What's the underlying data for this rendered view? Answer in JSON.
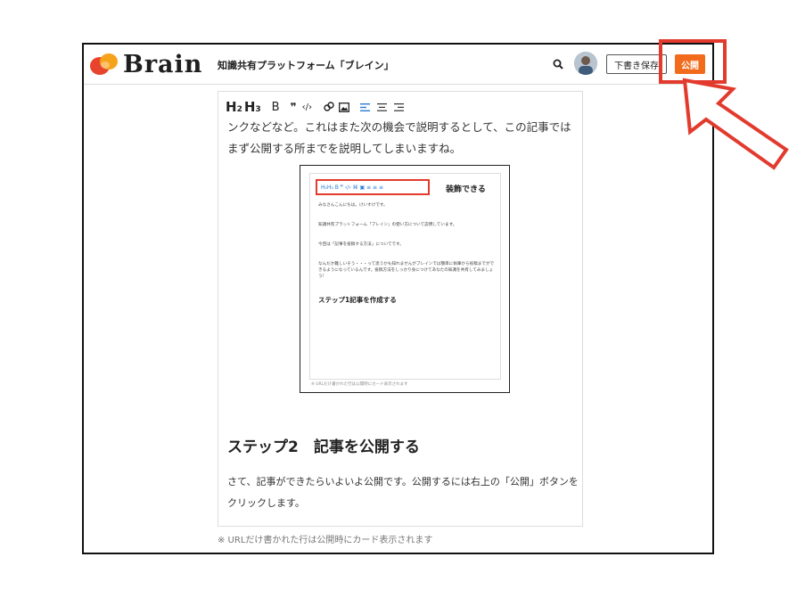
{
  "header": {
    "logo_text": "Brain",
    "tagline": "知識共有プラットフォーム「ブレイン」",
    "draft_label": "下書き保存",
    "publish_label": "公開",
    "brand_color": "#f26a1b"
  },
  "toolbar": {
    "items": [
      "H₂",
      "H₃",
      "B",
      "❞",
      "‹/›",
      "link-icon",
      "image-icon",
      "align-left-icon",
      "align-center-icon",
      "align-right-icon"
    ]
  },
  "editor": {
    "para1": "ンクなどなど。これはまた次の機会で説明するとして、この記事ではまず公開する所までを説明してしまいますね。",
    "heading2": "ステップ2　記事を公開する",
    "para2": "さて、記事ができたらいよいよ公開です。公開するには右上の「公開」ボタンをクリックします。",
    "url_note": "※ URLだけ書かれた行は公開時にカード表示されます"
  },
  "figure": {
    "toolbar_text": "H₂H₃ B ❞ ‹/› ⌘ ▣ ≡ ≡ ≡",
    "label": "装飾できる",
    "lines": [
      "みなさんこんにちは。けいすけです。",
      "知識共有プラットフォーム「ブレイン」の使い方について説明しています。",
      "今回は「記事を投稿する方法」についてです。",
      "なんだか難しいそう・・・って思うかも知れませんがブレインでは簡単に執筆から投稿までができるようになっているんです。投稿方法をしっかり身につけてあなたの知識を共有してみましょう！"
    ],
    "heading": "ステップ1記事を作成する",
    "note": "※ URLだけ書かれた行は公開時にカード表示されます"
  },
  "annotation_color": "#e23b2e"
}
